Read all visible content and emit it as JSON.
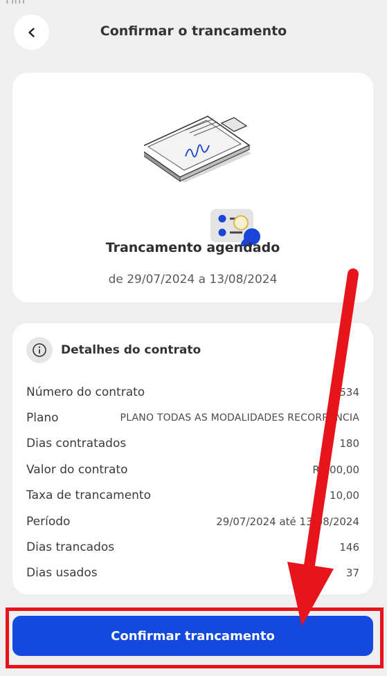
{
  "top_cut_text": "Fim",
  "header": {
    "back_icon": "chevron-left-icon",
    "title": "Confirmar o trancamento"
  },
  "status": {
    "illustration": "clipboard-signature-illustration",
    "title": "Trancamento agendado",
    "dates": "de 29/07/2024 a 13/08/2024"
  },
  "details": {
    "icon": "info-icon",
    "title": "Detalhes do contrato",
    "rows": [
      {
        "label": "Número do contrato",
        "value": "534"
      },
      {
        "label": "Plano",
        "value": "PLANO TODAS AS MODALIDADES RECORRENCIA"
      },
      {
        "label": "Dias contratados",
        "value": "180"
      },
      {
        "label": "Valor do contrato",
        "value": "R$ 00,00"
      },
      {
        "label": "Taxa de trancamento",
        "value": "$ 10,00"
      },
      {
        "label": "Período",
        "value": "29/07/2024 até 13/08/2024"
      },
      {
        "label": "Dias trancados",
        "value": "146"
      },
      {
        "label": "Dias usados",
        "value": "37"
      }
    ]
  },
  "confirm_button": "Confirmar trancamento",
  "colors": {
    "primary": "#1449e0",
    "annotation": "#e8141b",
    "background": "#efefef"
  }
}
